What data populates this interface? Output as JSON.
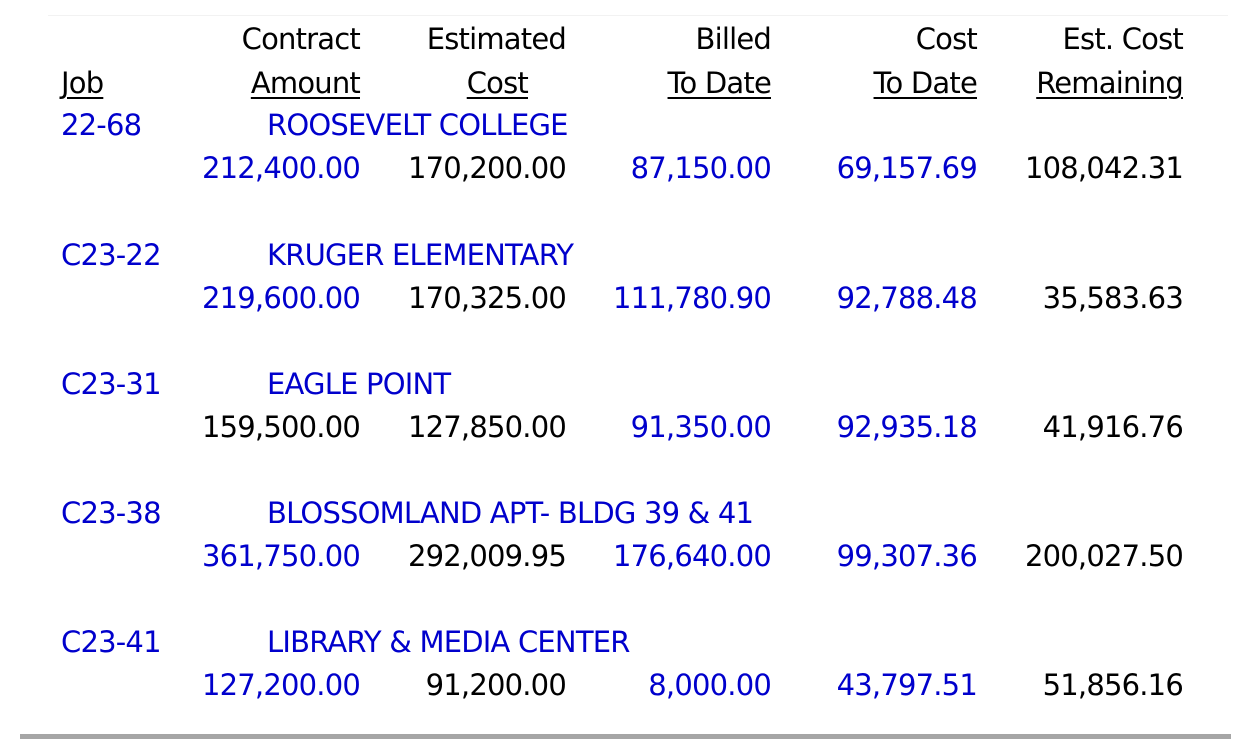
{
  "report": {
    "headers": {
      "job": {
        "line1": "",
        "line2": "Job"
      },
      "contract_amount": {
        "line1": "Contract",
        "line2": "Amount"
      },
      "estimated_cost": {
        "line1": "Estimated",
        "line2": "Cost"
      },
      "billed_to_date": {
        "line1": "Billed",
        "line2": "To Date"
      },
      "cost_to_date": {
        "line1": "Cost",
        "line2": "To Date"
      },
      "est_cost_remaining": {
        "line1": "Est. Cost",
        "line2": "Remaining"
      }
    },
    "colors": {
      "link": "#0000cc",
      "text": "#000000",
      "rule": "#a6a6a6"
    },
    "jobs": [
      {
        "job": "22-68",
        "name": "ROOSEVELT COLLEGE",
        "contract_amount": "212,400.00",
        "estimated_cost": "170,200.00",
        "billed_to_date": "87,150.00",
        "cost_to_date": "69,157.69",
        "est_cost_remaining": "108,042.31",
        "contract_amount_link": true
      },
      {
        "job": "C23-22",
        "name": "KRUGER ELEMENTARY",
        "contract_amount": "219,600.00",
        "estimated_cost": "170,325.00",
        "billed_to_date": "111,780.90",
        "cost_to_date": "92,788.48",
        "est_cost_remaining": "35,583.63",
        "contract_amount_link": true
      },
      {
        "job": "C23-31",
        "name": "EAGLE POINT",
        "contract_amount": "159,500.00",
        "estimated_cost": "127,850.00",
        "billed_to_date": "91,350.00",
        "cost_to_date": "92,935.18",
        "est_cost_remaining": "41,916.76",
        "contract_amount_link": false
      },
      {
        "job": "C23-38",
        "name": "BLOSSOMLAND APT- BLDG 39 & 41",
        "contract_amount": "361,750.00",
        "estimated_cost": "292,009.95",
        "billed_to_date": "176,640.00",
        "cost_to_date": "99,307.36",
        "est_cost_remaining": "200,027.50",
        "contract_amount_link": true
      },
      {
        "job": "C23-41",
        "name": "LIBRARY & MEDIA CENTER",
        "contract_amount": "127,200.00",
        "estimated_cost": "91,200.00",
        "billed_to_date": "8,000.00",
        "cost_to_date": "43,797.51",
        "est_cost_remaining": "51,856.16",
        "contract_amount_link": true
      }
    ]
  }
}
